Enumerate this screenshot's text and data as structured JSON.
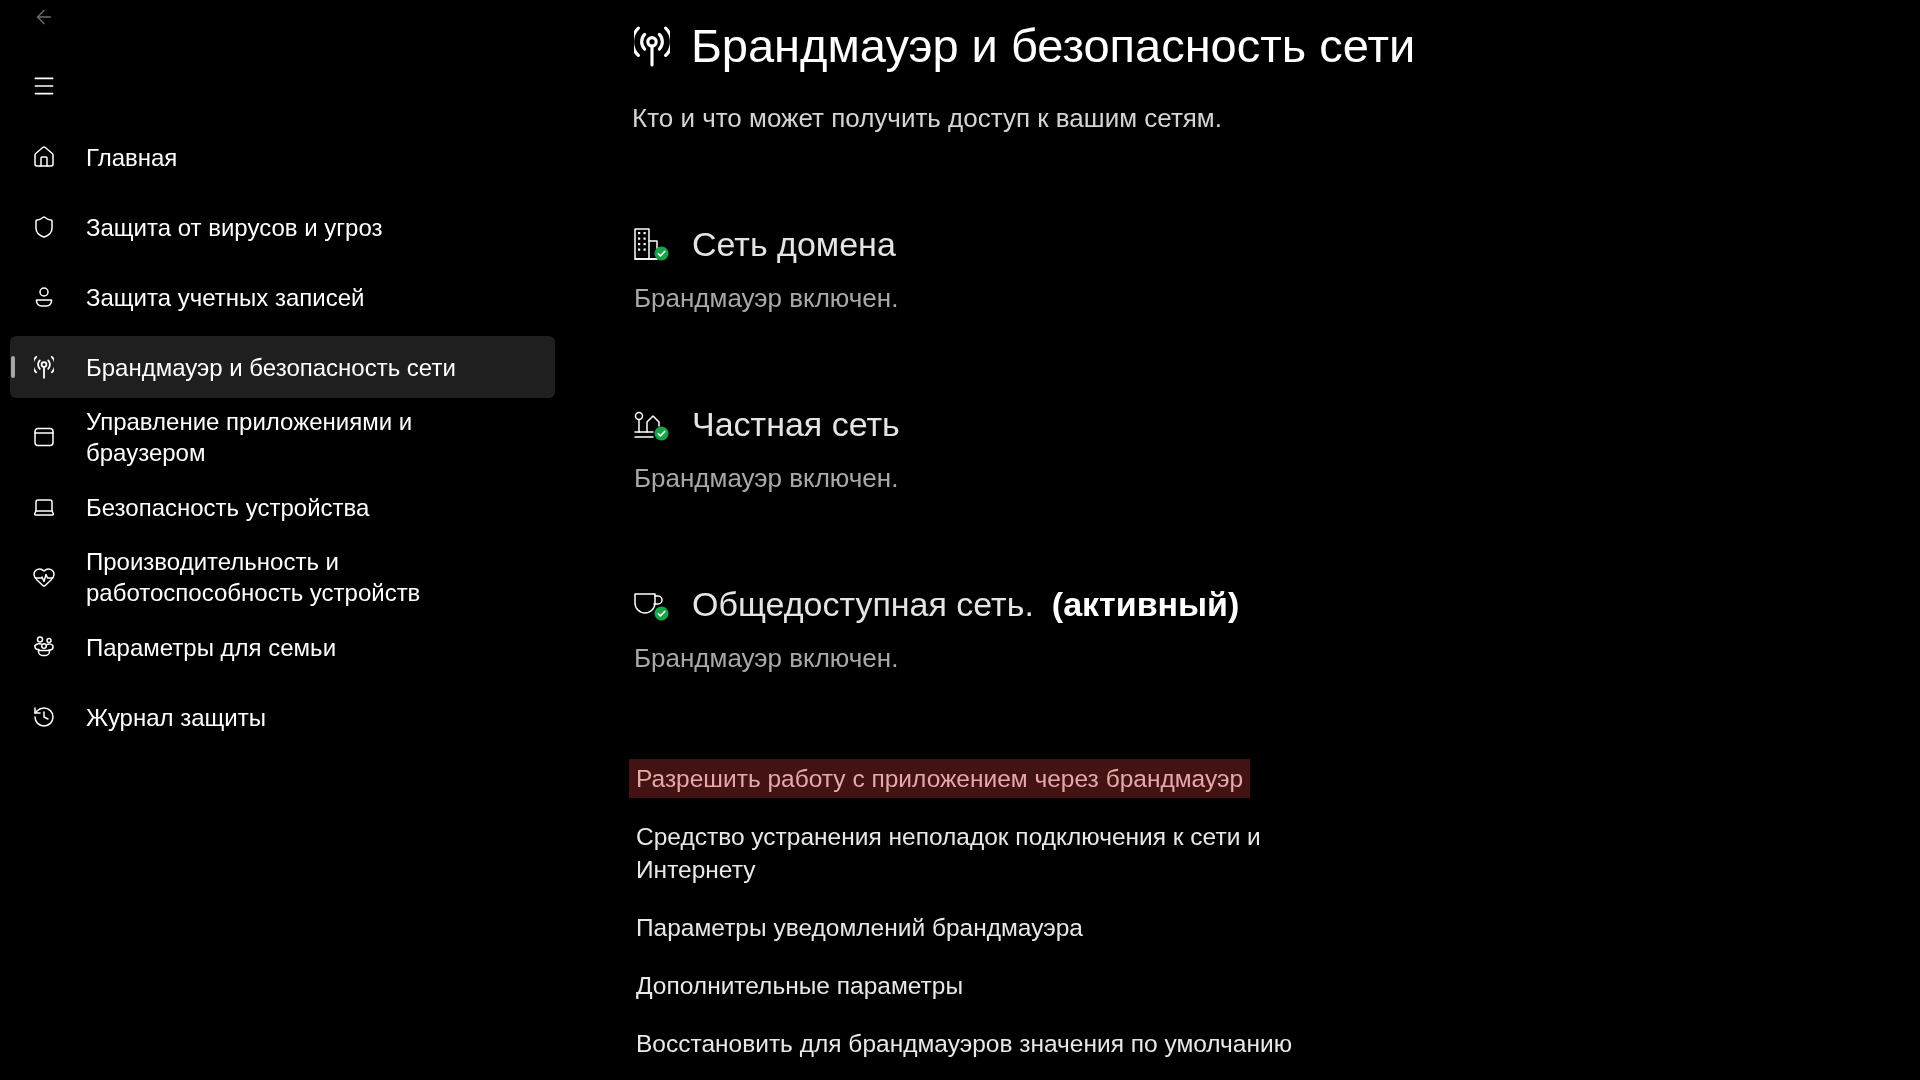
{
  "back_button": {
    "disabled": true
  },
  "sidebar": {
    "items": [
      {
        "label": "Главная",
        "selected": false
      },
      {
        "label": "Защита от вирусов и угроз",
        "selected": false
      },
      {
        "label": "Защита учетных записей",
        "selected": false
      },
      {
        "label": "Брандмауэр и безопасность сети",
        "selected": true
      },
      {
        "label": "Управление приложениями и браузером",
        "selected": false
      },
      {
        "label": "Безопасность устройства",
        "selected": false
      },
      {
        "label": "Производительность и работоспособность устройств",
        "selected": false
      },
      {
        "label": "Параметры для семьи",
        "selected": false
      },
      {
        "label": "Журнал защиты",
        "selected": false
      }
    ]
  },
  "page": {
    "title": "Брандмауэр и безопасность сети",
    "subtitle": "Кто и что может получить доступ к вашим сетям."
  },
  "networks": [
    {
      "name": "Сеть домена",
      "status": "Брандмауэр включен.",
      "firewall_on": true
    },
    {
      "name": "Частная сеть",
      "status": "Брандмауэр включен.",
      "firewall_on": true
    },
    {
      "name": "Общедоступная сеть.",
      "tag": "(активный)",
      "status": "Брандмауэр включен.",
      "firewall_on": true
    }
  ],
  "links": [
    {
      "label": "Разрешить работу с приложением через брандмауэр",
      "highlighted": true
    },
    {
      "label": "Средство устранения неполадок подключения к сети и Интернету",
      "highlighted": false
    },
    {
      "label": "Параметры уведомлений брандмауэра",
      "highlighted": false
    },
    {
      "label": "Дополнительные параметры",
      "highlighted": false
    },
    {
      "label": "Восстановить для брандмауэров значения по умолчанию",
      "highlighted": false
    }
  ]
}
